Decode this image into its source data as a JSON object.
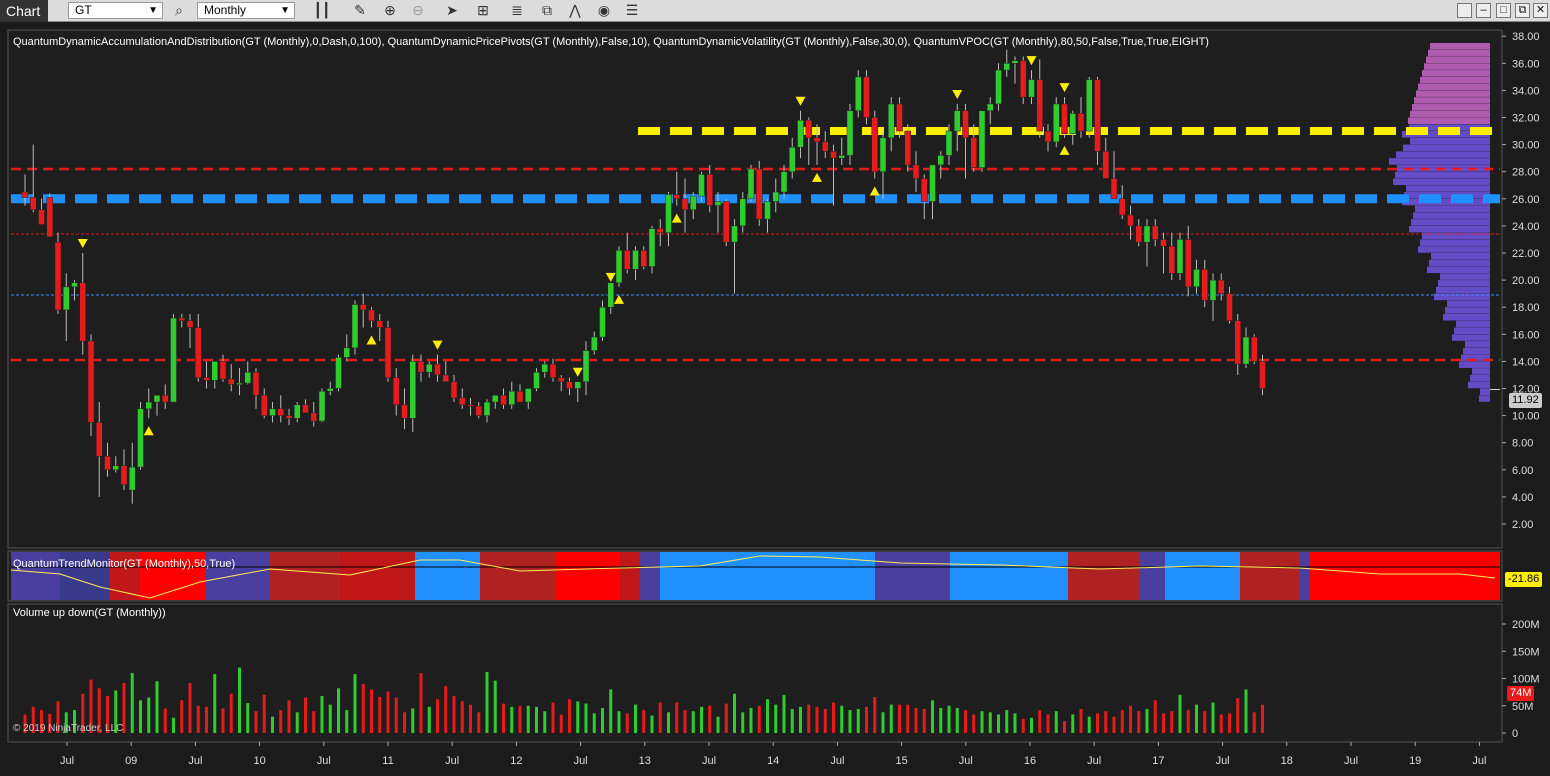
{
  "toolbar": {
    "chart_tab": "Chart",
    "instrument": "GT",
    "timeframe": "Monthly"
  },
  "main_panel": {
    "indicator_label": "QuantumDynamicAccumulationAndDistribution(GT (Monthly),0,Dash,0,100), QuantumDynamicPricePivots(GT (Monthly),False,10), QuantumDynamicVolatility(GT (Monthly),False,30,0), QuantumVPOC(GT (Monthly),80,50,False,True,True,EIGHT)",
    "last_price": "11.92",
    "y_ticks": [
      "38.00",
      "36.00",
      "34.00",
      "32.00",
      "30.00",
      "28.00",
      "26.00",
      "24.00",
      "22.00",
      "20.00",
      "18.00",
      "16.00",
      "14.00",
      "12.00",
      "10.00",
      "8.00",
      "6.00",
      "4.00",
      "2.00"
    ]
  },
  "trend_panel": {
    "label": "QuantumTrendMonitor(GT (Monthly),50,True)",
    "value": "-21.86"
  },
  "volume_panel": {
    "label": "Volume up down(GT (Monthly))",
    "y_ticks": [
      "200M",
      "150M",
      "100M",
      "50M",
      "0"
    ],
    "last_volume": "74M"
  },
  "x_ticks": [
    "Jul",
    "09",
    "Jul",
    "10",
    "Jul",
    "11",
    "Jul",
    "12",
    "Jul",
    "13",
    "Jul",
    "14",
    "Jul",
    "15",
    "Jul",
    "16",
    "Jul",
    "17",
    "Jul",
    "18",
    "Jul",
    "19",
    "Jul"
  ],
  "copyright": "© 2019 NinjaTrader, LLC",
  "colors": {
    "up": "#2ecc2e",
    "down": "#e61b1b",
    "resistance": "#ffee00",
    "support": "#2090ff",
    "vpoc_low": "#7b5cff",
    "vpoc_high": "#e070e0"
  },
  "chart_data": {
    "type": "candlestick",
    "timeframe": "Monthly",
    "ylim": [
      2,
      38
    ],
    "start": "2008-04",
    "bars": [
      [
        26.5,
        27.8,
        25.5,
        26.1
      ],
      [
        26.1,
        30.0,
        25.0,
        25.2
      ],
      [
        25.2,
        26.0,
        24.5,
        24.1
      ],
      [
        26.1,
        26.4,
        23.5,
        23.2
      ],
      [
        22.8,
        23.5,
        17.5,
        17.8
      ],
      [
        17.8,
        20.5,
        15.5,
        19.5
      ],
      [
        19.5,
        20.0,
        18.5,
        19.8
      ],
      [
        19.8,
        22.0,
        14.5,
        15.5
      ],
      [
        15.5,
        16.0,
        8.5,
        9.5
      ],
      [
        9.5,
        11.0,
        4.0,
        7.0
      ],
      [
        7.0,
        8.0,
        5.5,
        6.0
      ],
      [
        6.0,
        7.0,
        5.8,
        6.3
      ],
      [
        6.3,
        7.5,
        4.5,
        4.9
      ],
      [
        4.5,
        8.0,
        3.5,
        6.2
      ],
      [
        6.2,
        11.0,
        6.0,
        10.5
      ],
      [
        10.5,
        12.0,
        9.8,
        11.0
      ],
      [
        11.0,
        11.5,
        10.0,
        11.5
      ],
      [
        11.5,
        12.3,
        10.5,
        11.0
      ],
      [
        11.0,
        17.5,
        11.0,
        17.2
      ],
      [
        17.2,
        17.5,
        16.5,
        17.0
      ],
      [
        17.0,
        17.5,
        15.0,
        16.5
      ],
      [
        16.5,
        17.5,
        12.5,
        12.8
      ],
      [
        12.8,
        14.0,
        12.0,
        12.6
      ],
      [
        12.6,
        14.0,
        12.0,
        14.0
      ],
      [
        14.0,
        14.5,
        12.5,
        12.7
      ],
      [
        12.7,
        13.8,
        11.8,
        12.3
      ],
      [
        12.3,
        13.5,
        11.5,
        12.4
      ],
      [
        12.4,
        14.0,
        12.3,
        13.2
      ],
      [
        13.2,
        13.5,
        10.5,
        11.5
      ],
      [
        11.5,
        12.0,
        9.8,
        10.0
      ],
      [
        10.0,
        11.0,
        9.5,
        10.5
      ],
      [
        10.5,
        11.5,
        9.5,
        10.0
      ],
      [
        10.0,
        10.5,
        9.3,
        9.8
      ],
      [
        9.8,
        11.0,
        9.5,
        10.8
      ],
      [
        10.8,
        11.2,
        10.2,
        10.2
      ],
      [
        10.2,
        11.0,
        9.2,
        9.6
      ],
      [
        9.6,
        12.0,
        9.5,
        11.8
      ],
      [
        11.8,
        12.5,
        11.5,
        12.0
      ],
      [
        12.0,
        14.5,
        11.8,
        14.3
      ],
      [
        14.3,
        16.0,
        14.0,
        15.0
      ],
      [
        15.0,
        18.5,
        14.5,
        18.2
      ],
      [
        18.2,
        19.0,
        16.5,
        17.8
      ],
      [
        17.8,
        18.0,
        16.5,
        17.0
      ],
      [
        17.0,
        17.5,
        15.5,
        16.5
      ],
      [
        16.5,
        17.0,
        12.5,
        12.8
      ],
      [
        12.8,
        13.5,
        10.0,
        10.8
      ],
      [
        10.8,
        12.0,
        9.0,
        9.8
      ],
      [
        9.8,
        14.5,
        8.8,
        14.0
      ],
      [
        14.0,
        14.5,
        12.5,
        13.2
      ],
      [
        13.2,
        14.0,
        12.8,
        13.8
      ],
      [
        13.8,
        14.5,
        12.5,
        13.0
      ],
      [
        13.0,
        14.0,
        12.5,
        12.5
      ],
      [
        12.5,
        13.0,
        11.0,
        11.3
      ],
      [
        11.3,
        12.0,
        10.5,
        10.8
      ],
      [
        10.8,
        11.3,
        10.0,
        10.7
      ],
      [
        10.7,
        11.0,
        9.8,
        10.0
      ],
      [
        10.0,
        11.2,
        9.5,
        11.0
      ],
      [
        11.0,
        11.5,
        10.5,
        11.5
      ],
      [
        11.5,
        12.0,
        10.5,
        10.8
      ],
      [
        10.8,
        12.5,
        10.5,
        11.8
      ],
      [
        11.8,
        12.3,
        11.0,
        11.0
      ],
      [
        11.0,
        12.0,
        10.5,
        12.0
      ],
      [
        12.0,
        13.5,
        11.8,
        13.2
      ],
      [
        13.2,
        14.0,
        12.8,
        13.8
      ],
      [
        13.8,
        14.2,
        12.5,
        12.8
      ],
      [
        12.8,
        13.0,
        11.8,
        12.5
      ],
      [
        12.5,
        12.8,
        11.5,
        12.0
      ],
      [
        12.0,
        12.5,
        11.0,
        12.5
      ],
      [
        12.5,
        15.5,
        11.5,
        14.8
      ],
      [
        14.8,
        16.2,
        14.5,
        15.8
      ],
      [
        15.8,
        18.5,
        15.5,
        18.0
      ],
      [
        18.0,
        19.5,
        17.5,
        19.8
      ],
      [
        19.8,
        22.5,
        19.5,
        22.2
      ],
      [
        22.2,
        23.5,
        20.5,
        20.8
      ],
      [
        20.8,
        22.5,
        20.0,
        22.2
      ],
      [
        22.2,
        22.5,
        20.8,
        21.0
      ],
      [
        21.0,
        24.0,
        20.5,
        23.8
      ],
      [
        23.8,
        24.5,
        22.5,
        23.5
      ],
      [
        23.5,
        26.5,
        22.5,
        26.3
      ],
      [
        26.3,
        28.0,
        25.5,
        26.0
      ],
      [
        26.0,
        27.5,
        23.5,
        25.2
      ],
      [
        25.2,
        26.5,
        24.5,
        26.2
      ],
      [
        26.2,
        28.0,
        25.8,
        27.8
      ],
      [
        27.8,
        28.5,
        25.0,
        25.5
      ],
      [
        25.5,
        26.5,
        23.5,
        25.8
      ],
      [
        25.8,
        26.0,
        22.5,
        22.8
      ],
      [
        22.8,
        24.5,
        19.0,
        24.0
      ],
      [
        24.0,
        26.5,
        23.5,
        26.0
      ],
      [
        26.0,
        28.5,
        25.8,
        28.2
      ],
      [
        28.2,
        28.8,
        24.0,
        24.5
      ],
      [
        24.5,
        26.0,
        23.5,
        25.8
      ],
      [
        25.8,
        27.5,
        25.0,
        26.5
      ],
      [
        26.5,
        28.5,
        26.0,
        28.0
      ],
      [
        28.0,
        30.5,
        27.5,
        29.8
      ],
      [
        29.8,
        32.5,
        29.0,
        31.8
      ],
      [
        31.8,
        32.0,
        28.5,
        30.5
      ],
      [
        30.5,
        31.5,
        28.5,
        30.2
      ],
      [
        30.2,
        31.0,
        29.0,
        29.5
      ],
      [
        29.5,
        30.0,
        25.5,
        29.0
      ],
      [
        29.0,
        30.5,
        28.5,
        29.2
      ],
      [
        29.2,
        33.0,
        28.5,
        32.5
      ],
      [
        32.5,
        35.5,
        32.0,
        35.0
      ],
      [
        35.0,
        35.5,
        31.5,
        32.0
      ],
      [
        32.0,
        32.5,
        27.5,
        28.0
      ],
      [
        28.0,
        31.0,
        26.0,
        30.5
      ],
      [
        30.5,
        33.5,
        29.5,
        33.0
      ],
      [
        33.0,
        33.5,
        30.5,
        31.0
      ],
      [
        31.0,
        31.5,
        28.0,
        28.5
      ],
      [
        28.5,
        29.5,
        26.5,
        27.5
      ],
      [
        27.5,
        27.8,
        24.5,
        25.8
      ],
      [
        25.8,
        28.5,
        24.5,
        28.5
      ],
      [
        28.5,
        29.5,
        27.5,
        29.2
      ],
      [
        29.2,
        31.5,
        28.5,
        31.0
      ],
      [
        31.0,
        33.0,
        29.5,
        32.5
      ],
      [
        32.5,
        33.0,
        27.5,
        30.5
      ],
      [
        30.5,
        31.5,
        28.0,
        28.3
      ],
      [
        28.3,
        32.5,
        28.0,
        32.5
      ],
      [
        32.5,
        33.5,
        31.5,
        33.0
      ],
      [
        33.0,
        36.0,
        32.5,
        35.5
      ],
      [
        35.5,
        37.0,
        35.0,
        36.0
      ],
      [
        36.0,
        36.5,
        34.5,
        36.2
      ],
      [
        36.2,
        36.5,
        33.0,
        33.5
      ],
      [
        33.5,
        35.5,
        33.0,
        34.8
      ],
      [
        34.8,
        36.3,
        30.5,
        31.0
      ],
      [
        31.0,
        31.5,
        29.5,
        30.2
      ],
      [
        30.2,
        33.5,
        29.8,
        33.0
      ],
      [
        33.0,
        33.5,
        30.5,
        30.8
      ],
      [
        30.8,
        32.5,
        30.0,
        32.3
      ],
      [
        32.3,
        33.5,
        30.5,
        31.0
      ],
      [
        31.0,
        35.0,
        30.5,
        34.8
      ],
      [
        34.8,
        35.0,
        28.5,
        29.5
      ],
      [
        29.5,
        30.5,
        27.5,
        27.5
      ],
      [
        27.5,
        29.5,
        26.0,
        26.0
      ],
      [
        26.0,
        27.0,
        24.5,
        24.8
      ],
      [
        24.8,
        25.5,
        23.0,
        24.0
      ],
      [
        24.0,
        24.5,
        22.5,
        22.8
      ],
      [
        22.8,
        24.5,
        21.0,
        24.0
      ],
      [
        24.0,
        24.5,
        22.5,
        23.0
      ],
      [
        23.0,
        23.5,
        20.5,
        22.5
      ],
      [
        22.5,
        23.5,
        20.0,
        20.5
      ],
      [
        20.5,
        23.5,
        20.0,
        23.0
      ],
      [
        23.0,
        24.0,
        18.8,
        19.5
      ],
      [
        19.5,
        21.5,
        19.0,
        20.8
      ],
      [
        20.8,
        21.5,
        18.0,
        18.5
      ],
      [
        18.5,
        20.5,
        17.0,
        20.0
      ],
      [
        20.0,
        20.5,
        18.5,
        19.0
      ],
      [
        19.0,
        19.5,
        16.8,
        17.0
      ],
      [
        17.0,
        17.5,
        13.0,
        13.8
      ],
      [
        13.8,
        16.5,
        13.5,
        15.8
      ],
      [
        15.8,
        16.0,
        13.8,
        14.0
      ],
      [
        14.0,
        14.5,
        11.5,
        12.0
      ]
    ],
    "volume_millions": [
      34,
      48,
      42,
      35,
      58,
      38,
      42,
      72,
      98,
      82,
      68,
      78,
      92,
      110,
      60,
      65,
      95,
      45,
      28,
      60,
      92,
      50,
      48,
      108,
      45,
      72,
      120,
      55,
      40,
      70,
      30,
      42,
      60,
      38,
      65,
      40,
      68,
      52,
      82,
      42,
      108,
      90,
      80,
      66,
      76,
      65,
      38,
      45,
      110,
      48,
      62,
      86,
      68,
      58,
      52,
      38,
      112,
      96,
      54,
      48,
      50,
      50,
      48,
      40,
      56,
      34,
      62,
      58,
      54,
      36,
      46,
      80,
      40,
      36,
      52,
      42,
      32,
      56,
      38,
      56,
      42,
      40,
      48,
      50,
      30,
      54,
      72,
      38,
      46,
      50,
      62,
      52,
      70,
      44,
      48,
      52,
      48,
      44,
      56,
      50,
      42,
      44,
      48,
      66,
      38,
      52,
      52,
      52,
      46,
      44,
      60,
      46,
      50,
      46,
      42,
      34,
      40,
      38,
      34,
      42,
      36,
      26,
      28,
      42,
      34,
      40,
      22,
      34,
      44,
      30,
      36,
      40,
      30,
      42,
      50,
      40,
      44,
      60,
      36,
      40,
      70,
      42,
      52,
      40,
      56,
      34,
      36,
      64,
      80,
      38,
      52,
      102,
      44,
      110,
      48,
      38,
      60,
      56,
      74
    ],
    "horizontal_levels": [
      {
        "price": 31.0,
        "color": "resistance",
        "style": "dash"
      },
      {
        "price": 28.2,
        "color": "red",
        "style": "dash"
      },
      {
        "price": 26.0,
        "color": "support",
        "style": "dash"
      },
      {
        "price": 23.4,
        "color": "red",
        "style": "dot"
      },
      {
        "price": 18.9,
        "color": "blue",
        "style": "dot"
      },
      {
        "price": 14.1,
        "color": "red",
        "style": "dash"
      },
      {
        "price": 11.92,
        "color": "white",
        "style": "solid"
      }
    ]
  }
}
